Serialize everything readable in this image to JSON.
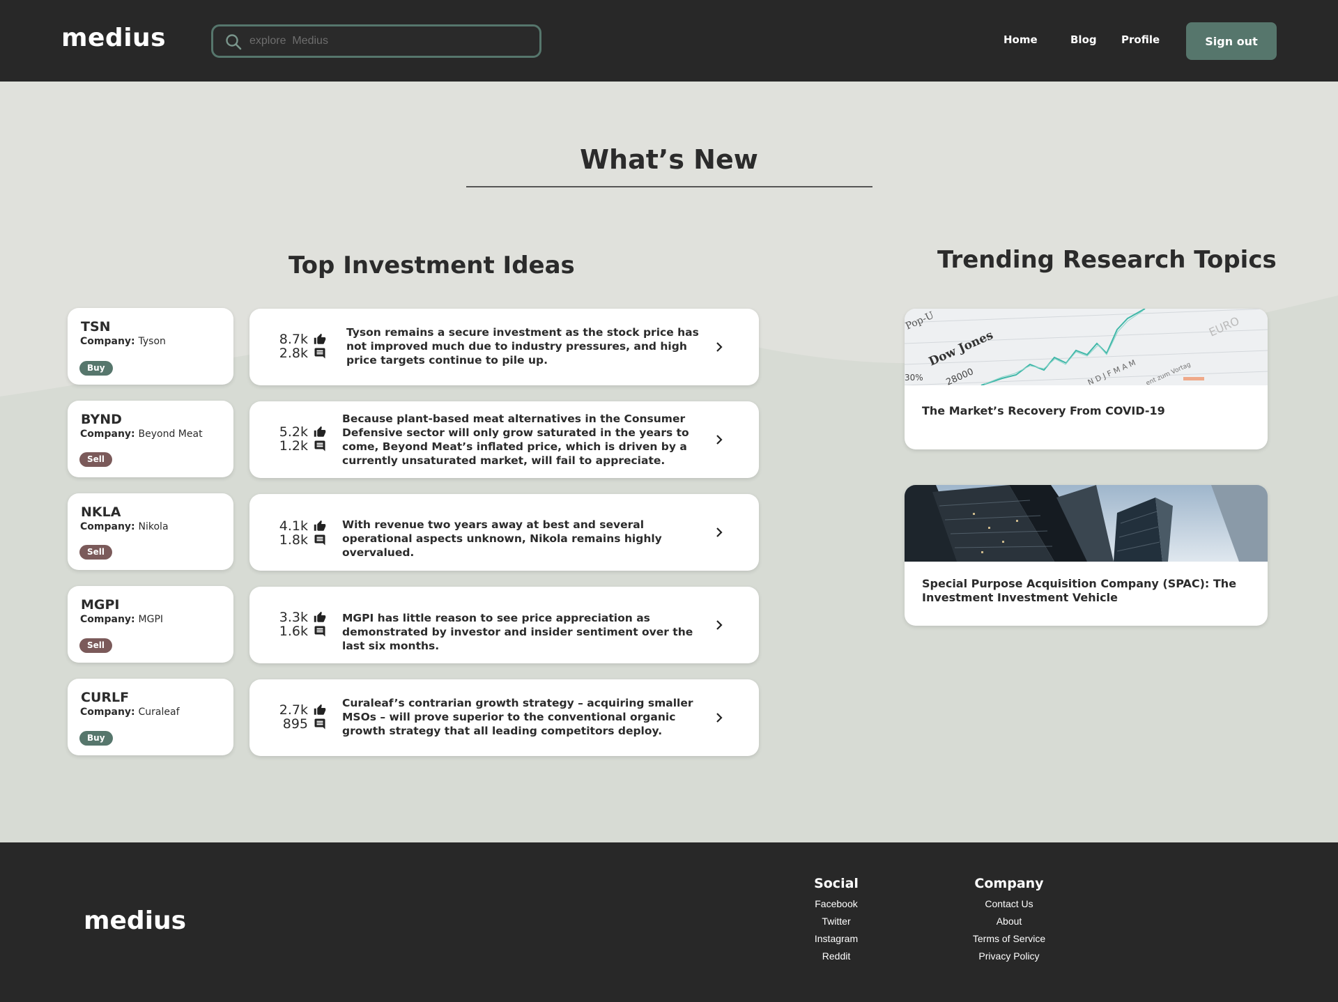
{
  "header": {
    "logo": "medius",
    "search_placeholder": "explore  Medius",
    "nav": [
      "Home",
      "Blog",
      "Profile"
    ],
    "signout_label": "Sign out"
  },
  "main": {
    "whats_new": "What’s New",
    "ideas_title": "Top Investment Ideas",
    "topics_title": "Trending Research Topics",
    "ideas": [
      {
        "ticker": "TSN",
        "company_label": "Company:",
        "company": "Tyson",
        "rating": "Buy",
        "likes": "8.7k",
        "comments": "2.8k",
        "text": "Tyson remains a secure investment as the stock price has not improved much due to industry pressures, and high price targets continue to pile up."
      },
      {
        "ticker": "BYND",
        "company_label": "Company:",
        "company": "Beyond Meat",
        "rating": "Sell",
        "likes": "5.2k",
        "comments": "1.2k",
        "text": "Because plant-based meat alternatives in the Consumer  Defensive sector will only grow saturated in the years to come, Beyond Meat’s inflated price, which is driven by a currently unsaturated market, will fail to appreciate."
      },
      {
        "ticker": "NKLA",
        "company_label": "Company:",
        "company": "Nikola",
        "rating": "Sell",
        "likes": "4.1k",
        "comments": "1.8k",
        "text": "With revenue two years away at best and several operational aspects unknown, Nikola remains highly overvalued."
      },
      {
        "ticker": "MGPI",
        "company_label": "Company:",
        "company": "MGPI",
        "rating": "Sell",
        "likes": "3.3k",
        "comments": "1.6k",
        "text": "MGPI has little reason to see price appreciation as demonstrated by investor and insider sentiment over the last six months."
      },
      {
        "ticker": "CURLF",
        "company_label": "Company:",
        "company": "Curaleaf",
        "rating": "Buy",
        "likes": "2.7k",
        "comments": "895",
        "text": "Curaleaf’s contrarian growth strategy – acquiring smaller MSOs – will prove superior to the conventional organic growth strategy that all leading competitors deploy."
      }
    ],
    "topics": [
      {
        "title": "The Market’s Recovery From COVID-19",
        "image_text": [
          "Dow Jones",
          "28000",
          "Pop-U",
          "30%",
          "EURO",
          "N D J F M A M",
          "ent zum Vortag"
        ]
      },
      {
        "title": "Special Purpose Acquisition Company (SPAC): The Investment Investment Vehicle"
      }
    ]
  },
  "footer": {
    "logo": "medius",
    "social_title": "Social",
    "social_links": [
      "Facebook",
      "Twitter",
      "Instagram",
      "Reddit"
    ],
    "company_title": "Company",
    "company_links": [
      "Contact Us",
      "About",
      "Terms of Service",
      "Privacy Policy"
    ]
  },
  "colors": {
    "header_bg": "#282828",
    "accent": "#56766c",
    "buy": "#56766c",
    "sell": "#7b5a5a",
    "page_bg": "#e0e1dc"
  }
}
